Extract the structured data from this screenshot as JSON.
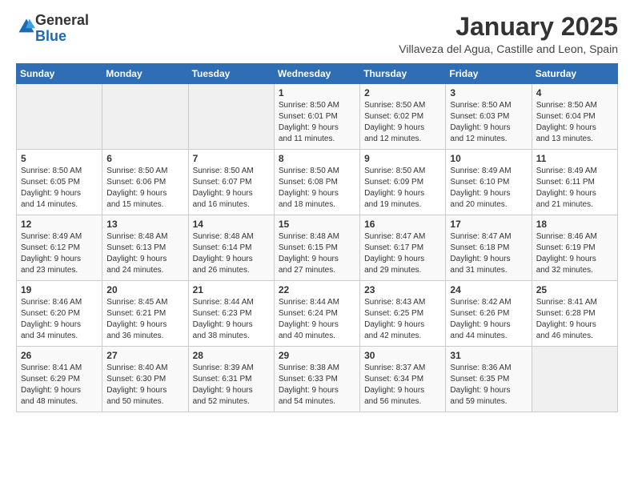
{
  "logo": {
    "general": "General",
    "blue": "Blue"
  },
  "title": {
    "month_year": "January 2025",
    "location": "Villaveza del Agua, Castille and Leon, Spain"
  },
  "weekdays": [
    "Sunday",
    "Monday",
    "Tuesday",
    "Wednesday",
    "Thursday",
    "Friday",
    "Saturday"
  ],
  "weeks": [
    [
      {
        "day": "",
        "info": ""
      },
      {
        "day": "",
        "info": ""
      },
      {
        "day": "",
        "info": ""
      },
      {
        "day": "1",
        "info": "Sunrise: 8:50 AM\nSunset: 6:01 PM\nDaylight: 9 hours\nand 11 minutes."
      },
      {
        "day": "2",
        "info": "Sunrise: 8:50 AM\nSunset: 6:02 PM\nDaylight: 9 hours\nand 12 minutes."
      },
      {
        "day": "3",
        "info": "Sunrise: 8:50 AM\nSunset: 6:03 PM\nDaylight: 9 hours\nand 12 minutes."
      },
      {
        "day": "4",
        "info": "Sunrise: 8:50 AM\nSunset: 6:04 PM\nDaylight: 9 hours\nand 13 minutes."
      }
    ],
    [
      {
        "day": "5",
        "info": "Sunrise: 8:50 AM\nSunset: 6:05 PM\nDaylight: 9 hours\nand 14 minutes."
      },
      {
        "day": "6",
        "info": "Sunrise: 8:50 AM\nSunset: 6:06 PM\nDaylight: 9 hours\nand 15 minutes."
      },
      {
        "day": "7",
        "info": "Sunrise: 8:50 AM\nSunset: 6:07 PM\nDaylight: 9 hours\nand 16 minutes."
      },
      {
        "day": "8",
        "info": "Sunrise: 8:50 AM\nSunset: 6:08 PM\nDaylight: 9 hours\nand 18 minutes."
      },
      {
        "day": "9",
        "info": "Sunrise: 8:50 AM\nSunset: 6:09 PM\nDaylight: 9 hours\nand 19 minutes."
      },
      {
        "day": "10",
        "info": "Sunrise: 8:49 AM\nSunset: 6:10 PM\nDaylight: 9 hours\nand 20 minutes."
      },
      {
        "day": "11",
        "info": "Sunrise: 8:49 AM\nSunset: 6:11 PM\nDaylight: 9 hours\nand 21 minutes."
      }
    ],
    [
      {
        "day": "12",
        "info": "Sunrise: 8:49 AM\nSunset: 6:12 PM\nDaylight: 9 hours\nand 23 minutes."
      },
      {
        "day": "13",
        "info": "Sunrise: 8:48 AM\nSunset: 6:13 PM\nDaylight: 9 hours\nand 24 minutes."
      },
      {
        "day": "14",
        "info": "Sunrise: 8:48 AM\nSunset: 6:14 PM\nDaylight: 9 hours\nand 26 minutes."
      },
      {
        "day": "15",
        "info": "Sunrise: 8:48 AM\nSunset: 6:15 PM\nDaylight: 9 hours\nand 27 minutes."
      },
      {
        "day": "16",
        "info": "Sunrise: 8:47 AM\nSunset: 6:17 PM\nDaylight: 9 hours\nand 29 minutes."
      },
      {
        "day": "17",
        "info": "Sunrise: 8:47 AM\nSunset: 6:18 PM\nDaylight: 9 hours\nand 31 minutes."
      },
      {
        "day": "18",
        "info": "Sunrise: 8:46 AM\nSunset: 6:19 PM\nDaylight: 9 hours\nand 32 minutes."
      }
    ],
    [
      {
        "day": "19",
        "info": "Sunrise: 8:46 AM\nSunset: 6:20 PM\nDaylight: 9 hours\nand 34 minutes."
      },
      {
        "day": "20",
        "info": "Sunrise: 8:45 AM\nSunset: 6:21 PM\nDaylight: 9 hours\nand 36 minutes."
      },
      {
        "day": "21",
        "info": "Sunrise: 8:44 AM\nSunset: 6:23 PM\nDaylight: 9 hours\nand 38 minutes."
      },
      {
        "day": "22",
        "info": "Sunrise: 8:44 AM\nSunset: 6:24 PM\nDaylight: 9 hours\nand 40 minutes."
      },
      {
        "day": "23",
        "info": "Sunrise: 8:43 AM\nSunset: 6:25 PM\nDaylight: 9 hours\nand 42 minutes."
      },
      {
        "day": "24",
        "info": "Sunrise: 8:42 AM\nSunset: 6:26 PM\nDaylight: 9 hours\nand 44 minutes."
      },
      {
        "day": "25",
        "info": "Sunrise: 8:41 AM\nSunset: 6:28 PM\nDaylight: 9 hours\nand 46 minutes."
      }
    ],
    [
      {
        "day": "26",
        "info": "Sunrise: 8:41 AM\nSunset: 6:29 PM\nDaylight: 9 hours\nand 48 minutes."
      },
      {
        "day": "27",
        "info": "Sunrise: 8:40 AM\nSunset: 6:30 PM\nDaylight: 9 hours\nand 50 minutes."
      },
      {
        "day": "28",
        "info": "Sunrise: 8:39 AM\nSunset: 6:31 PM\nDaylight: 9 hours\nand 52 minutes."
      },
      {
        "day": "29",
        "info": "Sunrise: 8:38 AM\nSunset: 6:33 PM\nDaylight: 9 hours\nand 54 minutes."
      },
      {
        "day": "30",
        "info": "Sunrise: 8:37 AM\nSunset: 6:34 PM\nDaylight: 9 hours\nand 56 minutes."
      },
      {
        "day": "31",
        "info": "Sunrise: 8:36 AM\nSunset: 6:35 PM\nDaylight: 9 hours\nand 59 minutes."
      },
      {
        "day": "",
        "info": ""
      }
    ]
  ]
}
